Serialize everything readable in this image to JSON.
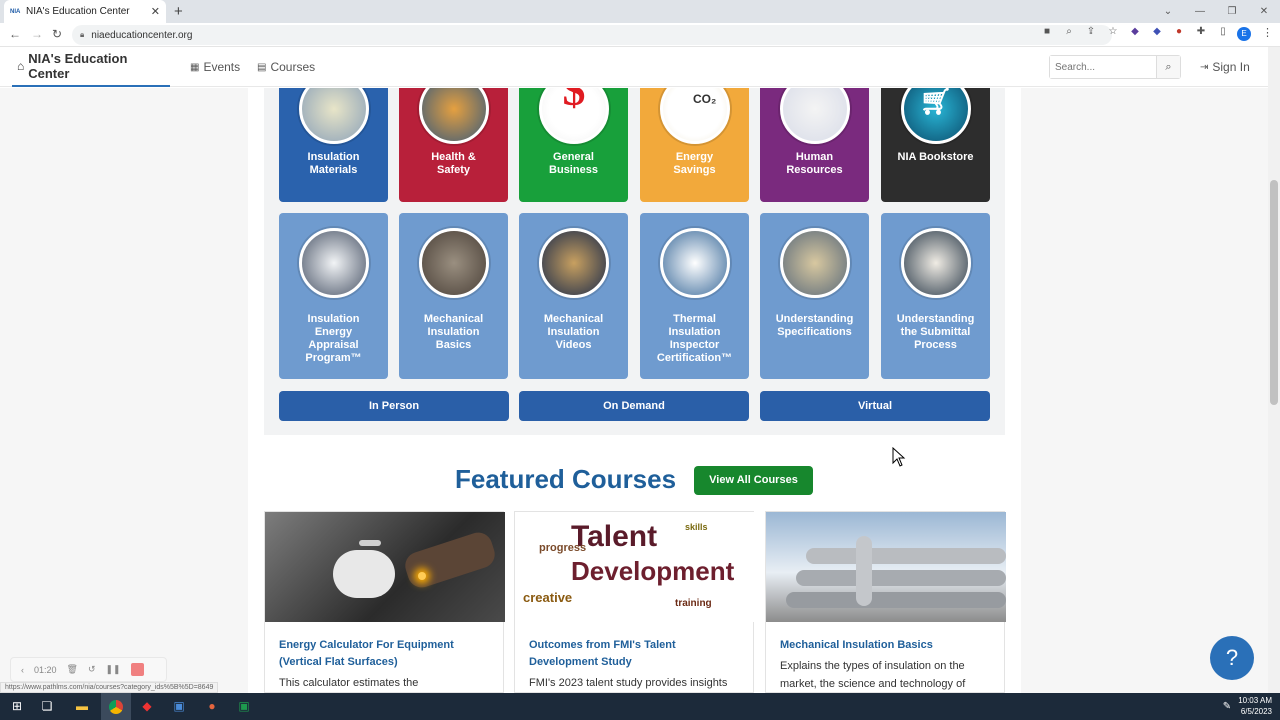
{
  "browser": {
    "tab_title": "NIA's Education Center",
    "favicon_text": "NIA",
    "url": "niaeducationcenter.org",
    "status_url": "https://www.pathlms.com/nia/courses?category_ids%5B%5D=8649"
  },
  "nav": {
    "brand": "NIA's Education Center",
    "events": "Events",
    "courses": "Courses",
    "search_placeholder": "Search...",
    "sign_in": "Sign In"
  },
  "categories": [
    {
      "label": "Insulation Materials",
      "color": "#2a62ad"
    },
    {
      "label": "Health & Safety",
      "color": "#b8203a"
    },
    {
      "label": "General Business",
      "color": "#18a03b"
    },
    {
      "label": "Energy Savings",
      "color": "#f2a93b"
    },
    {
      "label": "Human Resources",
      "color": "#7a2a7e"
    },
    {
      "label": "NIA Bookstore",
      "color": "#2d2d2d"
    },
    {
      "label": "Insulation Energy Appraisal Program™",
      "color": "#6f9bcf"
    },
    {
      "label": "Mechanical Insulation Basics",
      "color": "#6f9bcf"
    },
    {
      "label": "Mechanical Insulation Videos",
      "color": "#6f9bcf"
    },
    {
      "label": "Thermal Insulation Inspector Certification™",
      "color": "#6f9bcf"
    },
    {
      "label": "Understanding Specifications",
      "color": "#6f9bcf"
    },
    {
      "label": "Understanding the Submittal Process",
      "color": "#6f9bcf"
    }
  ],
  "icon_text": {
    "dollar": "$",
    "co2": "CO₂"
  },
  "modes": {
    "in_person": "In Person",
    "on_demand": "On Demand",
    "virtual": "Virtual"
  },
  "featured": {
    "heading": "Featured Courses",
    "view_all": "View All Courses",
    "cards": [
      {
        "title": "Energy Calculator For Equipment (Vertical Flat Surfaces)",
        "desc": "This calculator estimates the"
      },
      {
        "title": "Outcomes from FMI's Talent Development Study",
        "desc": "FMI's 2023 talent study provides insights"
      },
      {
        "title": "Mechanical Insulation Basics",
        "desc": "Explains the types of insulation on the market, the science and technology of"
      }
    ],
    "wordcloud": {
      "big1": "Talent",
      "big2": "Development",
      "w3": "progress",
      "w4": "creative",
      "w5": "skills",
      "w6": "training"
    }
  },
  "recorder": {
    "time": "01:20"
  },
  "taskbar": {
    "time": "10:03 AM",
    "date": "6/5/2023"
  },
  "profile_initial": "E",
  "colors": {
    "accent": "#1f5f9a",
    "brand_blue": "#2a70b8",
    "green_button": "#17872d"
  }
}
